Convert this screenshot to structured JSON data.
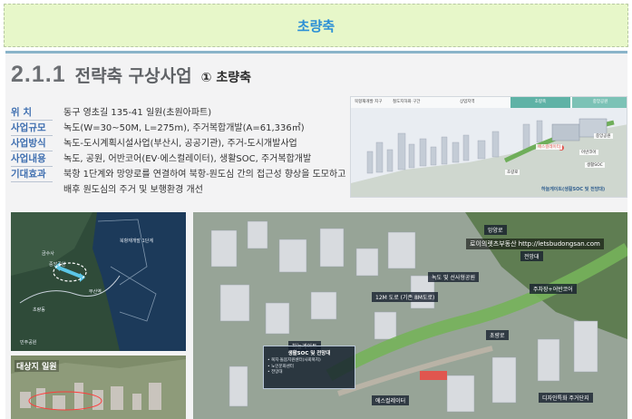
{
  "banner": {
    "title": "초량축"
  },
  "heading": {
    "number": "2.1.1",
    "title": "전략축 구상사업",
    "subtitle": "① 초량축"
  },
  "info_rows": [
    {
      "label": "위    치",
      "value": "동구 영초길 135-41 일원(초원아파트)"
    },
    {
      "label": "사업규모",
      "value": "녹도(W=30~50M, L=275m), 주거복합개발(A=61,336㎡)"
    },
    {
      "label": "사업방식",
      "value": "녹도-도시계획시설사업(부산시, 공공기관), 주거-도시개발사업"
    },
    {
      "label": "사업내용",
      "value": "녹도, 공원, 어반코어(EV·에스컬레이터), 생활SOC, 주거복합개발"
    },
    {
      "label": "기대효과",
      "value": "북항 1단계와 망양로를 연결하여 북항-원도심 간의 접근성 향상을 도모하고"
    },
    {
      "label": "",
      "value": "배후 원도심의 주거 및 보행환경 개선"
    }
  ],
  "diagram": {
    "header_tags": [
      "북항재개발 지구",
      "철도지하화 구간",
      "상업지역",
      "초량축",
      "중앙공원"
    ],
    "labels": [
      "에스컬레이터",
      "어반코어",
      "중앙공원",
      "초량로",
      "생활SOC"
    ],
    "caption": "하늘게이트(생활SOC 및 전망대)"
  },
  "map": {
    "labels": [
      "북항재개발 1단계",
      "중앙공원",
      "부산역",
      "금수사",
      "초량동",
      "민주공원"
    ]
  },
  "photo": {
    "label": "대상지 일원"
  },
  "render": {
    "watermark": "로이의렛츠부동산 http://letsbudongsan.com",
    "tags": [
      "망양로",
      "녹도 및 선사형공원",
      "12M 도로 (기존 8M도로)",
      "주차장+어반코어",
      "하늘게이트",
      "에스컬레이터",
      "디자인특화 주거단지",
      "전망대",
      "초량로"
    ],
    "box": {
      "title": "생활SOC 및 전망대",
      "items": [
        "• 복지·돌봄지원센터(사회복지)",
        "• 노인문화센터",
        "• 전망대"
      ]
    }
  },
  "colors": {
    "banner_bg": "#e7f7c9",
    "banner_text": "#2b8fd6",
    "label_blue": "#3f6fb0",
    "teal": "#5fb2a6"
  }
}
